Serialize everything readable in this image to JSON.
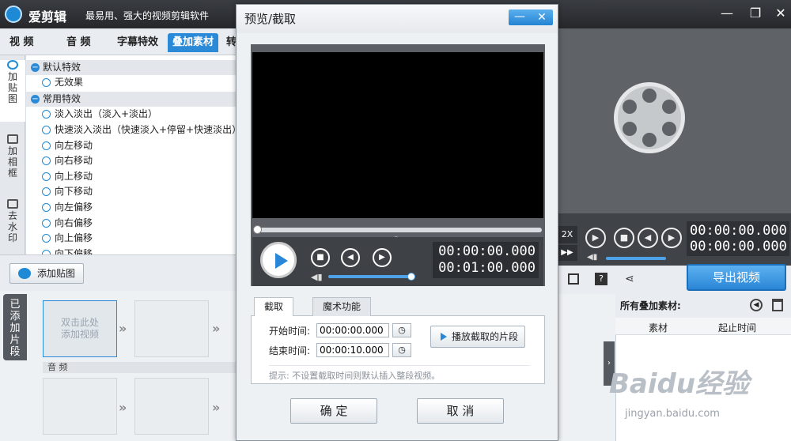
{
  "app": {
    "title": "爱剪辑",
    "slogan": "最易用、强大的视频剪辑软件"
  },
  "tabs": [
    "视  频",
    "音  频",
    "字幕特效",
    "叠加素材",
    "转"
  ],
  "side_tabs": [
    "加贴图",
    "加相框",
    "去水印"
  ],
  "effects": {
    "group1": "默认特效",
    "group1_items": [
      "无效果"
    ],
    "group2": "常用特效",
    "group2_items": [
      "淡入淡出（淡入+淡出）",
      "快速淡入淡出（快速淡入+停留+快速淡出）",
      "向左移动",
      "向右移动",
      "向上移动",
      "向下移动",
      "向左偏移",
      "向右偏移",
      "向上偏移",
      "向下偏移"
    ]
  },
  "add_sticker": "添加贴图",
  "timeline": {
    "added_tab": "已添加片段",
    "slot_hint": "双击此处\n添加视频",
    "audio_label": "音  频"
  },
  "right": {
    "time1": "00:00:00.000",
    "time2": "00:00:00.000",
    "speed": "2X",
    "export": "导出视频",
    "overlay_title": "所有叠加素材:",
    "col1": "素材",
    "col2": "起止时间"
  },
  "watermark": {
    "brand": "Baidu经验",
    "url": "jingyan.baidu.com"
  },
  "dialog": {
    "title": "预览/截取",
    "time_current": "00:00:00.000",
    "time_total": "00:01:00.000",
    "tabs": [
      "截取",
      "魔术功能"
    ],
    "start_label": "开始时间:",
    "start_value": "00:00:00.000",
    "end_label": "结束时间:",
    "end_value": "00:00:10.000",
    "play_cut": "播放截取的片段",
    "hint": "提示: 不设置截取时间则默认插入整段视频。",
    "ok": "确  定",
    "cancel": "取  消"
  },
  "colors": {
    "accent": "#2a8ad8",
    "dark": "#404449"
  }
}
